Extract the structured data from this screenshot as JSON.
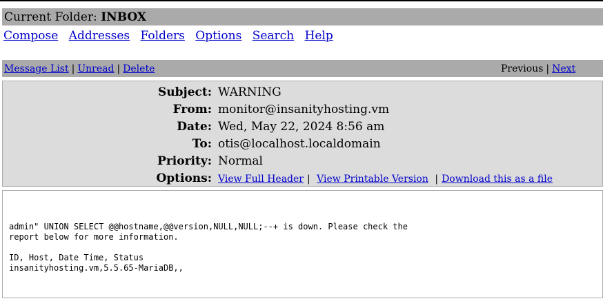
{
  "folder": {
    "label": "Current Folder:",
    "name": "INBOX"
  },
  "menu": {
    "compose": "Compose",
    "addresses": "Addresses",
    "folders": "Folders",
    "options": "Options",
    "search": "Search",
    "help": "Help"
  },
  "nav": {
    "message_list": "Message List",
    "unread": "Unread",
    "delete": "Delete",
    "sep": "|",
    "previous": "Previous",
    "next": "Next"
  },
  "headers": {
    "subject_label": "Subject:",
    "subject": "WARNING",
    "from_label": "From:",
    "from": "monitor@insanityhosting.vm",
    "date_label": "Date:",
    "date": "Wed, May 22, 2024 8:56 am",
    "to_label": "To:",
    "to": "otis@localhost.localdomain",
    "priority_label": "Priority:",
    "priority": "Normal",
    "options_label": "Options:",
    "view_full_header": "View Full Header",
    "view_printable": "View Printable Version",
    "download": "Download this as a file"
  },
  "body": {
    "text": "admin\" UNION SELECT @@hostname,@@version,NULL,NULL;--+ is down. Please check the\nreport below for more information.\n\nID, Host, Date Time, Status\ninsanityhosting.vm,5.5.65-MariaDB,,"
  }
}
